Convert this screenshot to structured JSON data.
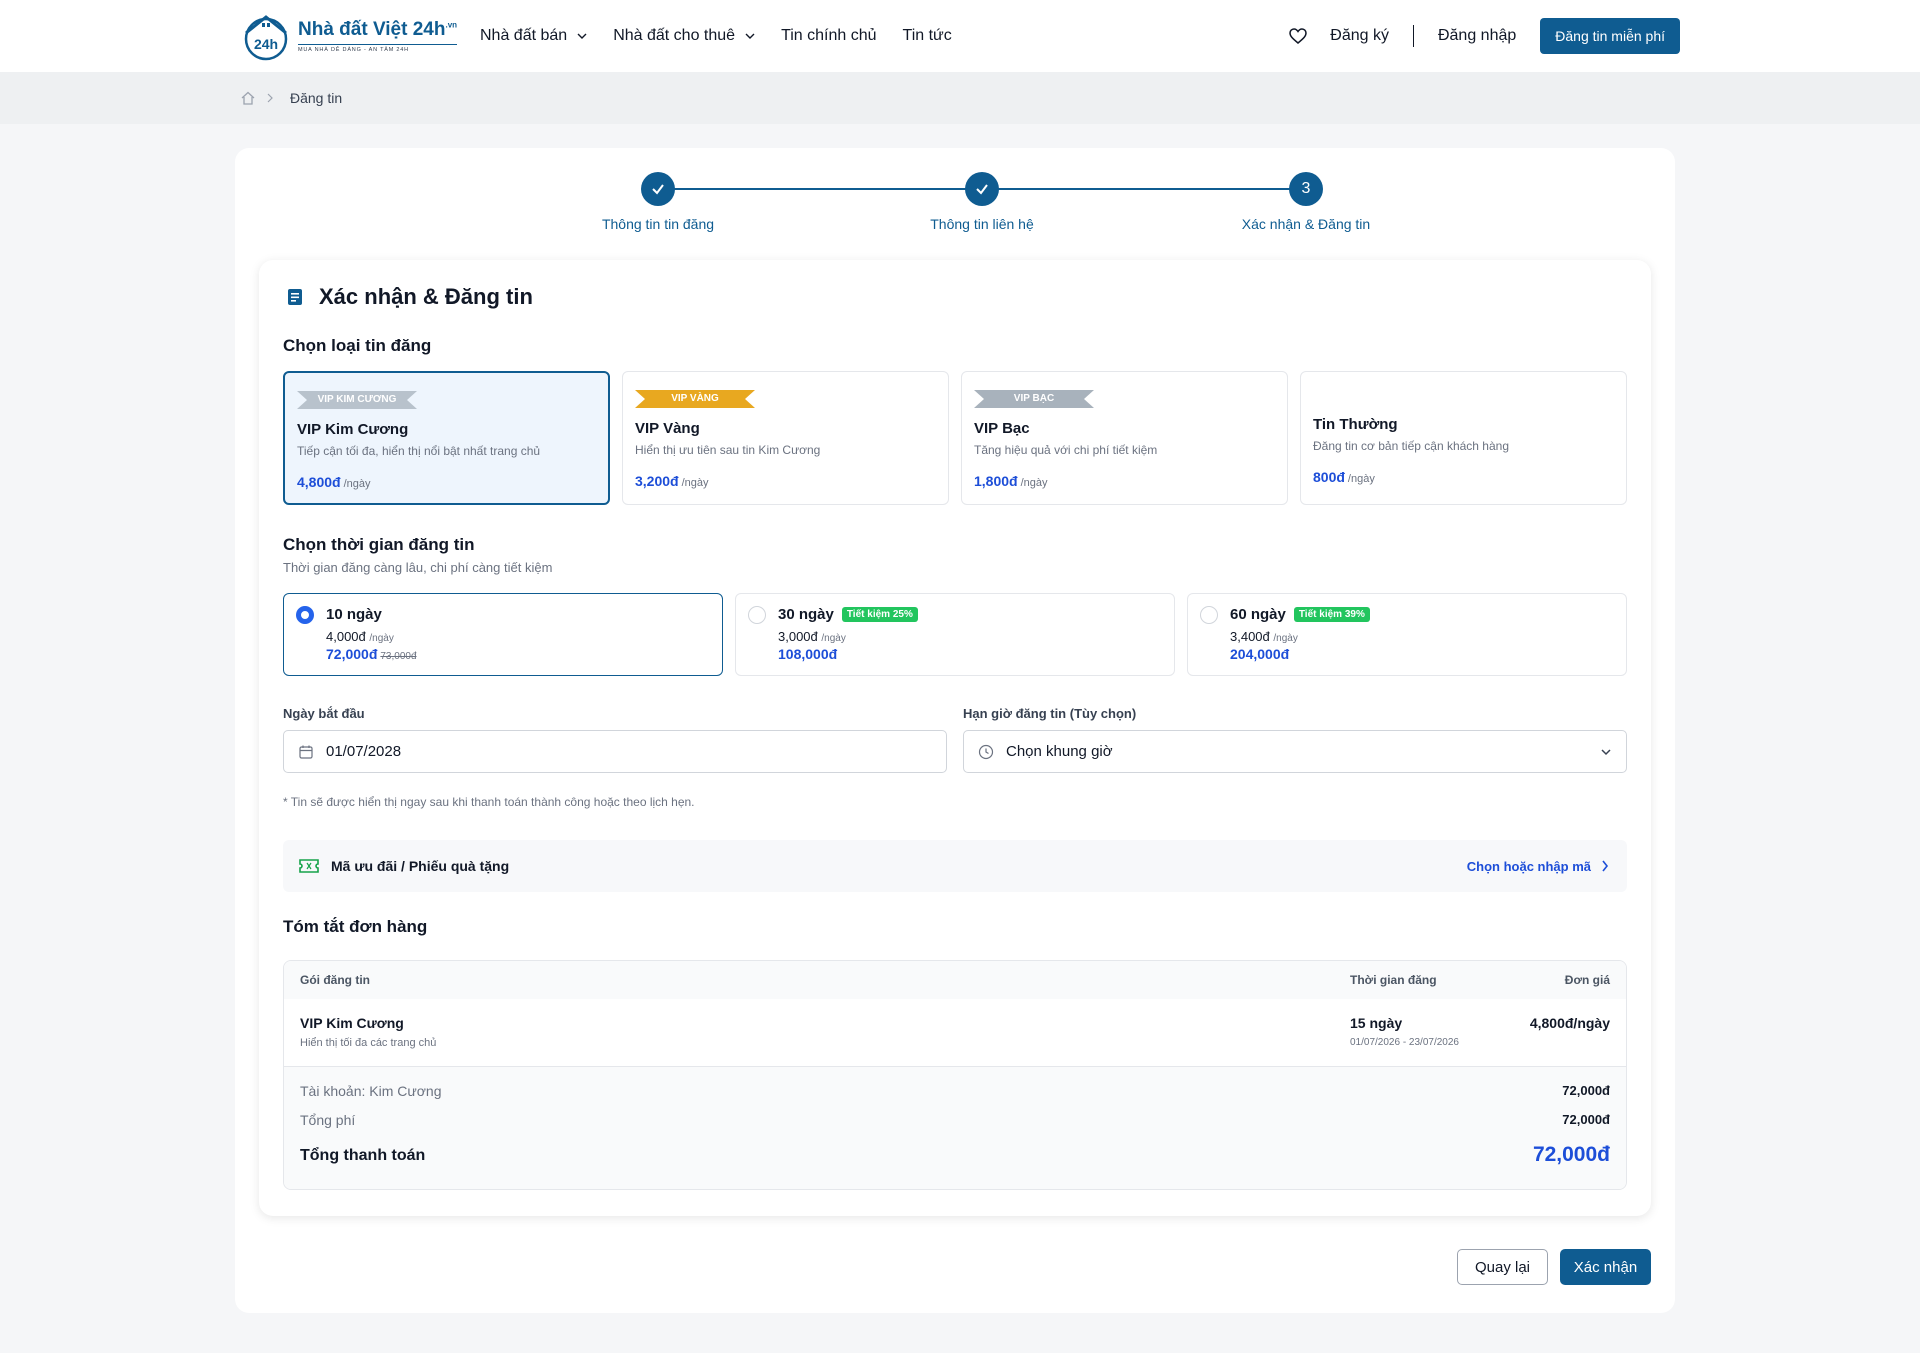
{
  "header": {
    "logo_name": "Nhà đất Việt 24h",
    "logo_suffix": ".vn",
    "logo_mark": "24h",
    "logo_tagline": "MUA NHÀ DỄ DÀNG - AN TÂM 24H",
    "nav": [
      "Nhà đất bán",
      "Nhà đất cho thuê",
      "Tin chính chủ",
      "Tin tức"
    ],
    "register": "Đăng ký",
    "login": "Đăng nhập",
    "post_button": "Đăng tin miễn phí"
  },
  "breadcrumb": {
    "current": "Đăng tin"
  },
  "stepper": {
    "steps": [
      "Thông tin tin đăng",
      "Thông tin liên hệ",
      "Xác nhận & Đăng tin"
    ],
    "current_number": "3"
  },
  "section": {
    "title": "Xác nhận & Đăng tin",
    "choose_type": "Chọn loại tin đăng",
    "choose_time": "Chọn thời gian đăng tin",
    "choose_time_sub": "Thời gian đăng càng lâu, chi phí càng tiết kiệm"
  },
  "packages": [
    {
      "badge": "VIP KIM CƯƠNG",
      "name": "VIP Kim Cương",
      "desc": "Tiếp cận tối đa, hiển thị nổi bật nhất trang chủ",
      "price": "4,800đ",
      "unit": "/ngày",
      "selected": true,
      "color": "#b8c2cc"
    },
    {
      "badge": "VIP VÀNG",
      "name": "VIP Vàng",
      "desc": "Hiển thị ưu tiên sau tin Kim Cương",
      "price": "3,200đ",
      "unit": "/ngày",
      "selected": false,
      "color": "#e8a820"
    },
    {
      "badge": "VIP BẠC",
      "name": "VIP Bạc",
      "desc": "Tăng hiệu quả với chi phí tiết kiệm",
      "price": "1,800đ",
      "unit": "/ngày",
      "selected": false,
      "color": "#a8b2bc"
    },
    {
      "badge": "",
      "name": "Tin Thường",
      "desc": "Đăng tin cơ bản tiếp cận khách hàng",
      "price": "800đ",
      "unit": "/ngày",
      "selected": false,
      "color": ""
    }
  ],
  "durations": [
    {
      "title": "10 ngày",
      "badge": "",
      "per": "4,000đ",
      "unit": "/ngày",
      "total": "72,000đ",
      "old": "73,000đ",
      "selected": true
    },
    {
      "title": "30 ngày",
      "badge": "Tiết kiệm 25%",
      "per": "3,000đ",
      "unit": "/ngày",
      "total": "108,000đ",
      "old": "",
      "selected": false
    },
    {
      "title": "60 ngày",
      "badge": "Tiết kiệm 39%",
      "per": "3,400đ",
      "unit": "/ngày",
      "total": "204,000đ",
      "old": "",
      "selected": false
    }
  ],
  "start_date": {
    "label": "Ngày bắt đầu",
    "value": "01/07/2028"
  },
  "time_slot": {
    "label": "Hạn giờ đăng tin (Tùy chọn)",
    "placeholder": "Chọn khung giờ"
  },
  "note": "* Tin sẽ được hiển thị ngay sau khi thanh toán thành công hoặc theo lịch hẹn.",
  "coupon": {
    "label": "Mã ưu đãi / Phiếu quà tặng",
    "link": "Chọn hoặc nhập mã"
  },
  "summary": {
    "title": "Tóm tắt đơn hàng",
    "col_package": "Gói đăng tin",
    "col_time": "Thời gian đăng",
    "col_price": "Đơn giá",
    "row": {
      "name": "VIP Kim Cương",
      "desc": "Hiển thị tối đa các trang chủ",
      "days": "15 ngày",
      "range": "01/07/2026 - 23/07/2026",
      "price": "4,800đ/ngày"
    },
    "account_label": "Tài khoản: Kim Cương",
    "account_value": "72,000đ",
    "fee_label": "Tổng phí",
    "fee_value": "72,000đ",
    "total_label": "Tổng thanh toán",
    "total_value": "72,000đ"
  },
  "actions": {
    "back": "Quay lại",
    "confirm": "Xác nhận"
  },
  "colors": {
    "primary": "#0f5c91",
    "accent": "#1d4ed8",
    "success": "#22c55e"
  }
}
